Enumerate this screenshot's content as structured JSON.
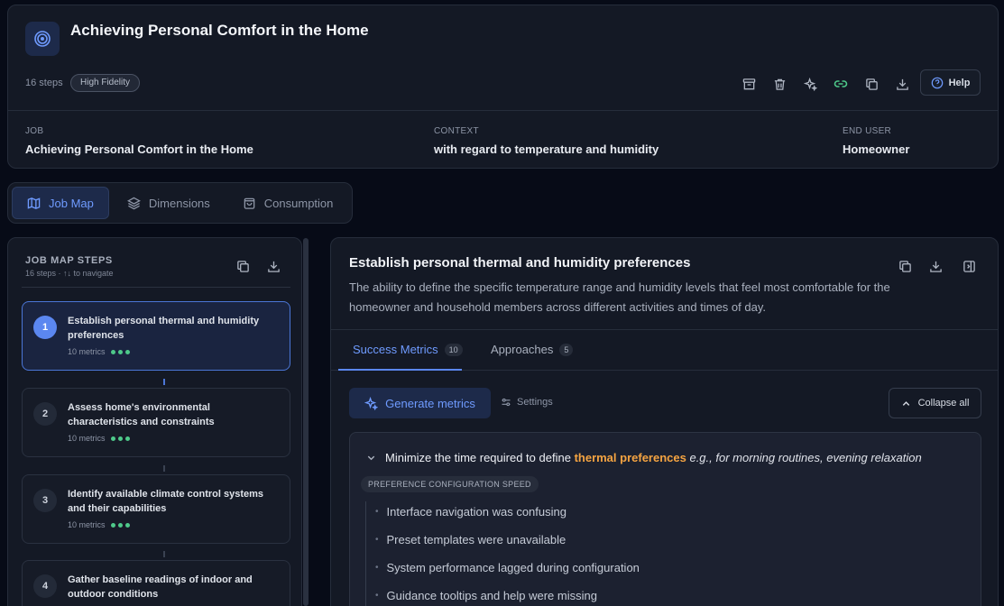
{
  "header": {
    "title": "Achieving Personal Comfort in the Home",
    "steps_count": "16 steps",
    "fidelity_badge": "High Fidelity",
    "help_label": "Help",
    "meta": [
      {
        "label": "JOB",
        "value": "Achieving Personal Comfort in the Home"
      },
      {
        "label": "CONTEXT",
        "value": "with regard to temperature and humidity"
      },
      {
        "label": "END USER",
        "value": "Homeowner"
      }
    ],
    "icons": [
      "archive-icon",
      "trash-icon",
      "sparkles-icon",
      "link-icon",
      "copy-icon",
      "download-icon"
    ]
  },
  "tabs": [
    {
      "label": "Job Map",
      "icon": "map-icon",
      "active": true
    },
    {
      "label": "Dimensions",
      "icon": "layers-icon",
      "active": false
    },
    {
      "label": "Consumption",
      "icon": "bag-icon",
      "active": false
    }
  ],
  "left_panel": {
    "title": "JOB MAP STEPS",
    "subtitle": "16 steps · ↑↓ to navigate",
    "steps": [
      {
        "num": "1",
        "title": "Establish personal thermal and humidity preferences",
        "metrics": "10 metrics"
      },
      {
        "num": "2",
        "title": "Assess home's environmental characteristics and constraints",
        "metrics": "10 metrics"
      },
      {
        "num": "3",
        "title": "Identify available climate control systems and their capabilities",
        "metrics": "10 metrics"
      },
      {
        "num": "4",
        "title": "Gather baseline readings of indoor and outdoor conditions",
        "metrics": ""
      }
    ]
  },
  "detail": {
    "title": "Establish personal thermal and humidity preferences",
    "description": "The ability to define the specific temperature range and humidity levels that feel most comfortable for the homeowner and household members across different activities and times of day.",
    "tabs": [
      {
        "label": "Success Metrics",
        "count": "10"
      },
      {
        "label": "Approaches",
        "count": "5"
      }
    ],
    "generate_label": "Generate metrics",
    "settings_label": "Settings",
    "collapse_label": "Collapse all",
    "metric": {
      "prefix": "Minimize the time required to define",
      "highlight": "thermal preferences",
      "example": "e.g., for morning routines, evening relaxation",
      "tag": "PREFERENCE CONFIGURATION SPEED",
      "bullets": [
        "Interface navigation was confusing",
        "Preset templates were unavailable",
        "System performance lagged during configuration",
        "Guidance tooltips and help were missing"
      ]
    }
  },
  "colors": {
    "accent": "#5b87f0",
    "highlight": "#f5a442",
    "dot": "#4ec98a"
  }
}
